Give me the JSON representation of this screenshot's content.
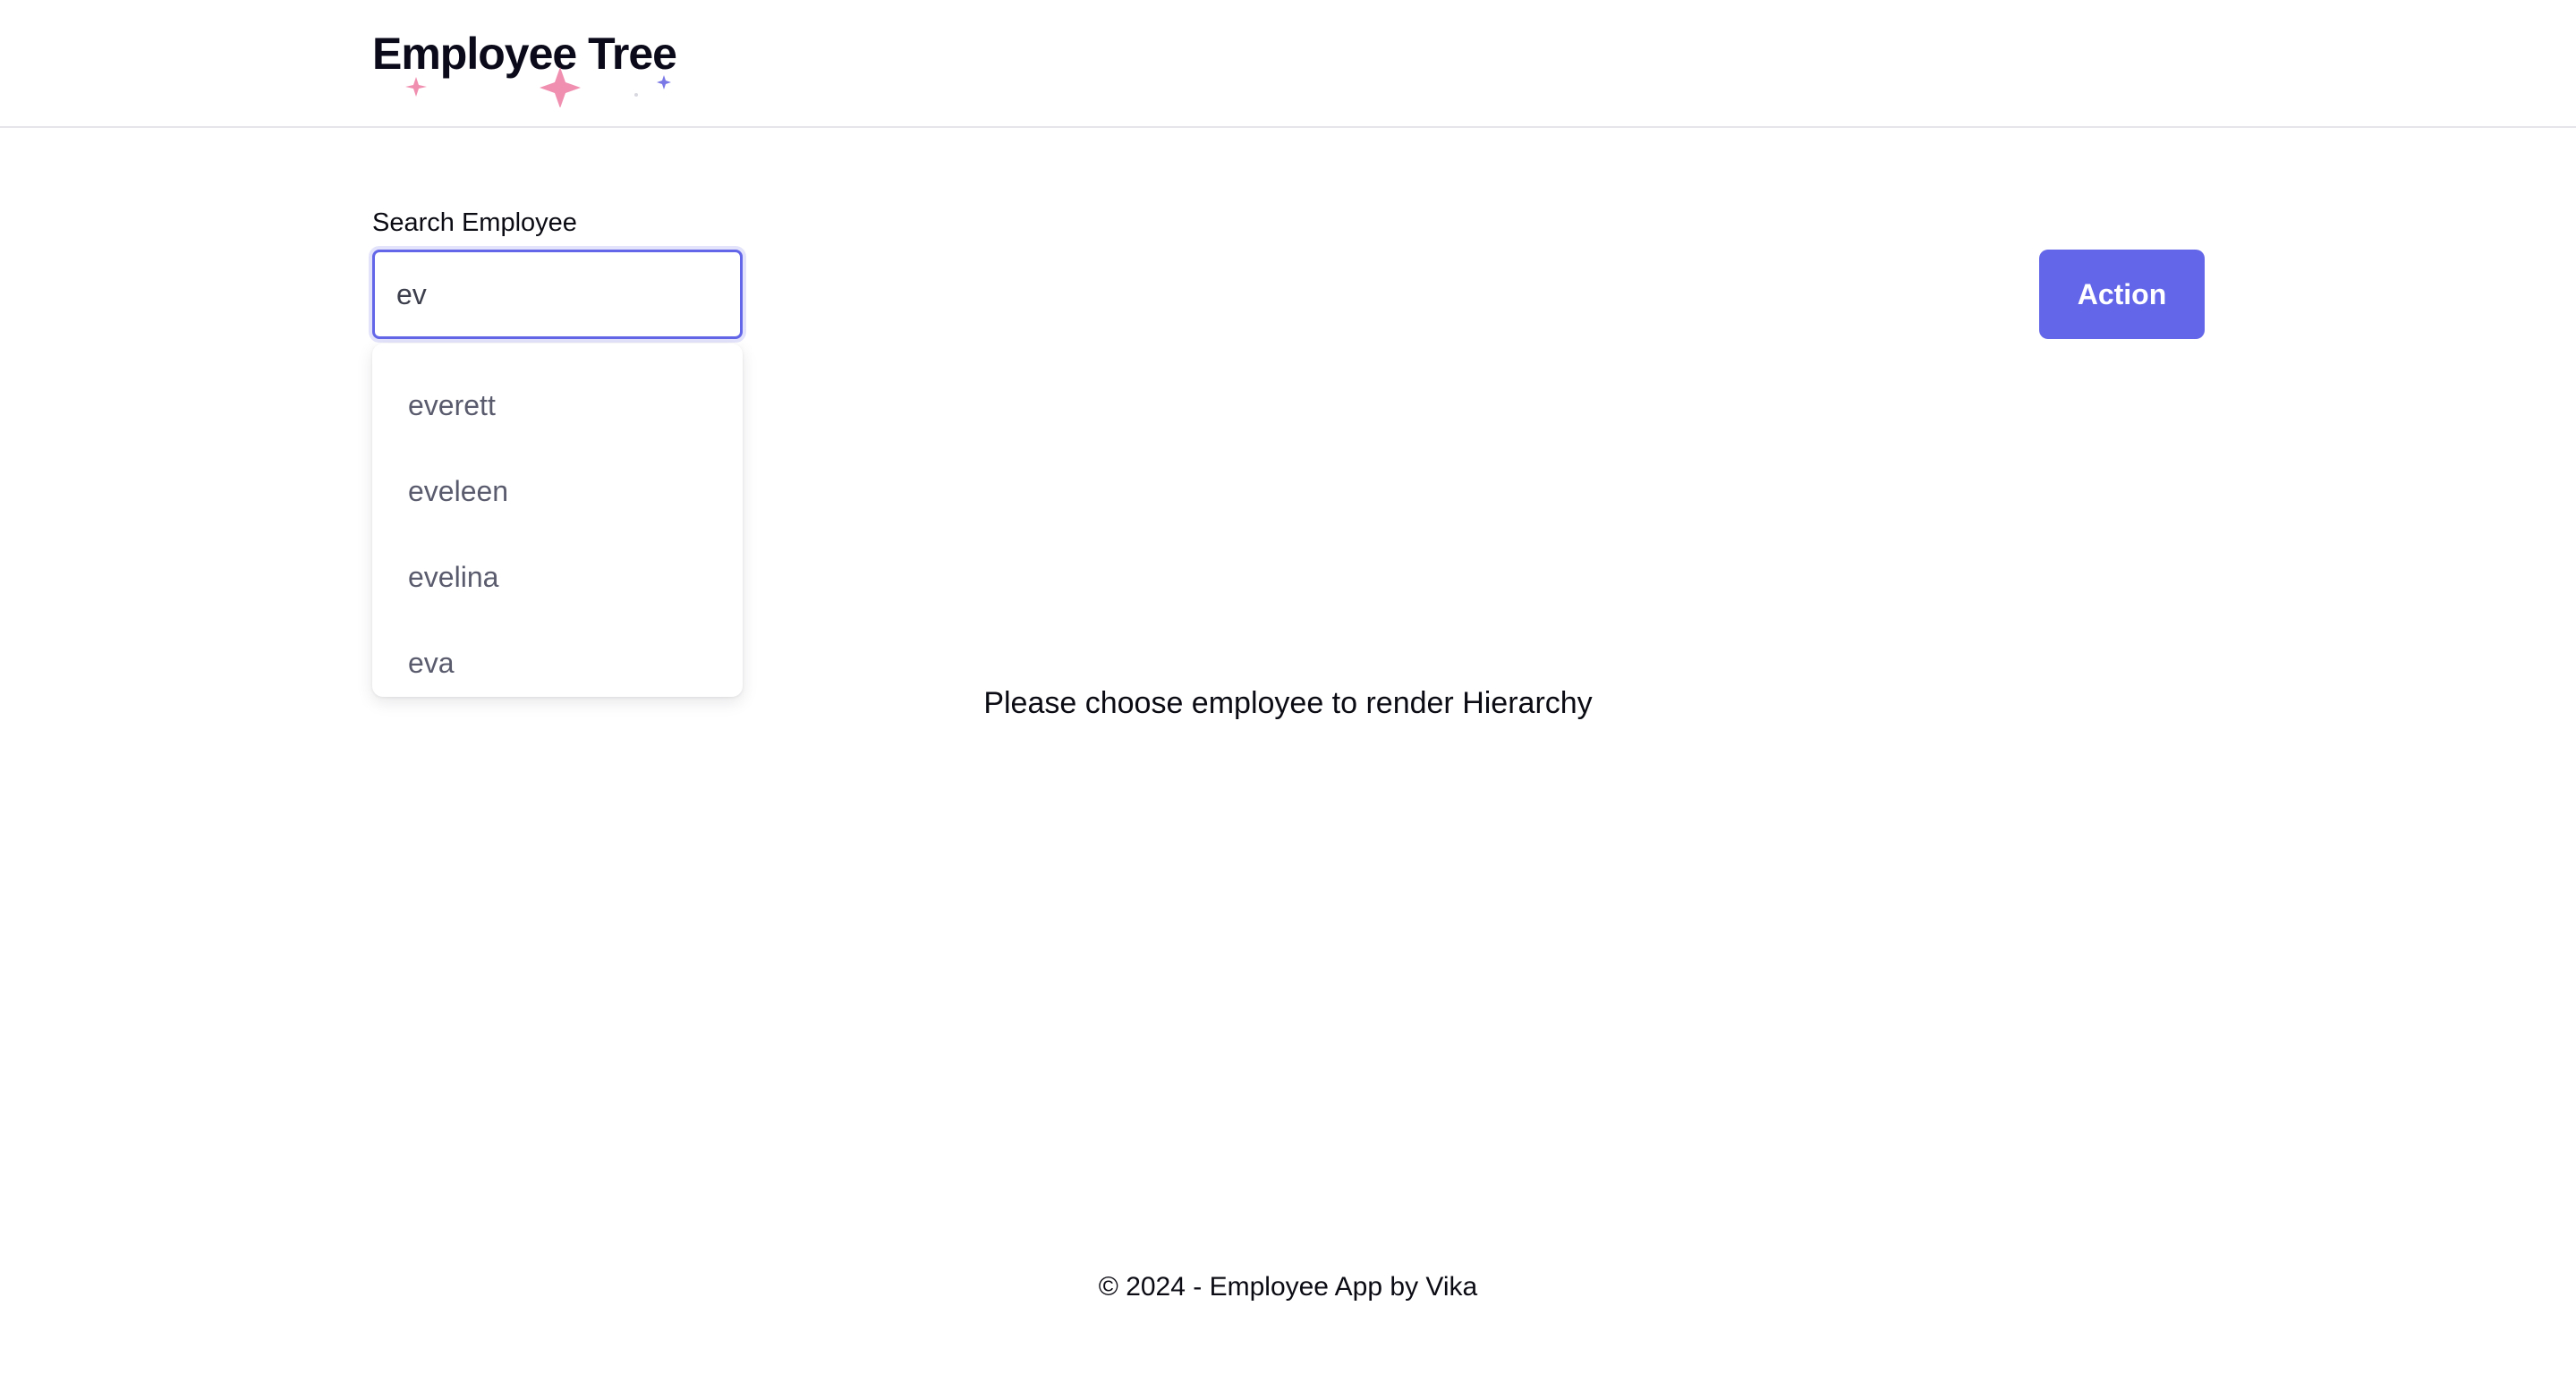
{
  "header": {
    "logo_text": "Employee Tree",
    "sparkle_colors": [
      "#f08fb0",
      "#f08fb0",
      "#d8d8e0",
      "#7a78e6"
    ]
  },
  "search": {
    "label": "Search Employee",
    "value": "ev",
    "suggestions": [
      "everett",
      "eveleen",
      "evelina",
      "eva"
    ]
  },
  "action_button": {
    "label": "Action"
  },
  "main": {
    "empty_message": "Please choose employee to render Hierarchy"
  },
  "footer": {
    "text": "© 2024 - Employee App by Vika"
  },
  "colors": {
    "accent": "#6366e8",
    "border": "#e6e6ea"
  }
}
